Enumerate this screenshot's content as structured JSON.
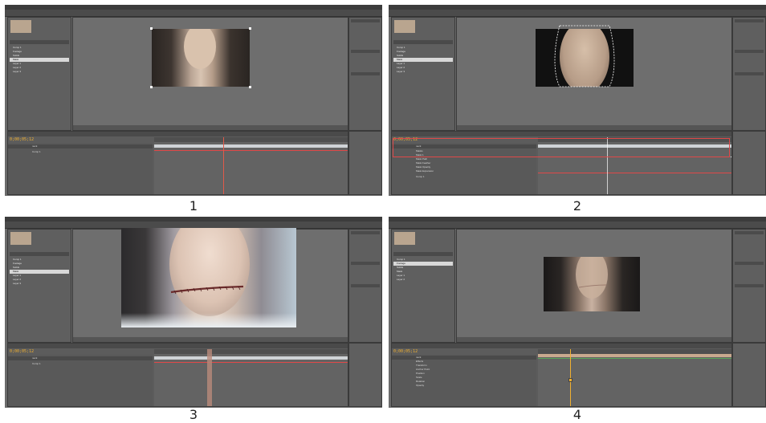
{
  "panels": [
    {
      "caption": "1",
      "timecode": "0;00;05;12",
      "project_items": [
        "Comp 1",
        "Footage",
        "Solids",
        "Mask",
        "Layer 1",
        "Layer 2",
        "Layer 3"
      ],
      "layer_rows": [
        "neck",
        "Comp 1"
      ],
      "variant": "plain"
    },
    {
      "caption": "2",
      "timecode": "0;00;05;12",
      "project_items": [
        "Comp 1",
        "Footage",
        "Solids",
        "Mask",
        "Layer 1",
        "Layer 2",
        "Layer 3"
      ],
      "layer_rows": [
        "neck",
        "Masks",
        "Mask 1",
        "Mask Path",
        "Mask Feather",
        "Mask Opacity",
        "Mask Expansion",
        "Comp 1"
      ],
      "variant": "masked"
    },
    {
      "caption": "3",
      "timecode": "0;00;05;12",
      "project_items": [
        "Comp 1",
        "Footage",
        "Solids",
        "Mask",
        "Layer 1",
        "Layer 2",
        "Layer 3"
      ],
      "layer_rows": [
        "neck",
        "Comp 1"
      ],
      "variant": "scar"
    },
    {
      "caption": "4",
      "timecode": "0;00;05;12",
      "project_items": [
        "Comp 1",
        "Footage",
        "Solids",
        "Mask",
        "Layer 1",
        "Layer 2"
      ],
      "layer_rows": [
        "neck",
        "Effects",
        "Transform",
        "Anchor Point",
        "Position",
        "Scale",
        "Rotation",
        "Opacity"
      ],
      "variant": "faded"
    }
  ],
  "colors": {
    "ui_bg": "#6b6b6b",
    "highlight_red": "#e04848",
    "timecode_orange": "#f0b030",
    "playhead": "#e05a4a"
  }
}
